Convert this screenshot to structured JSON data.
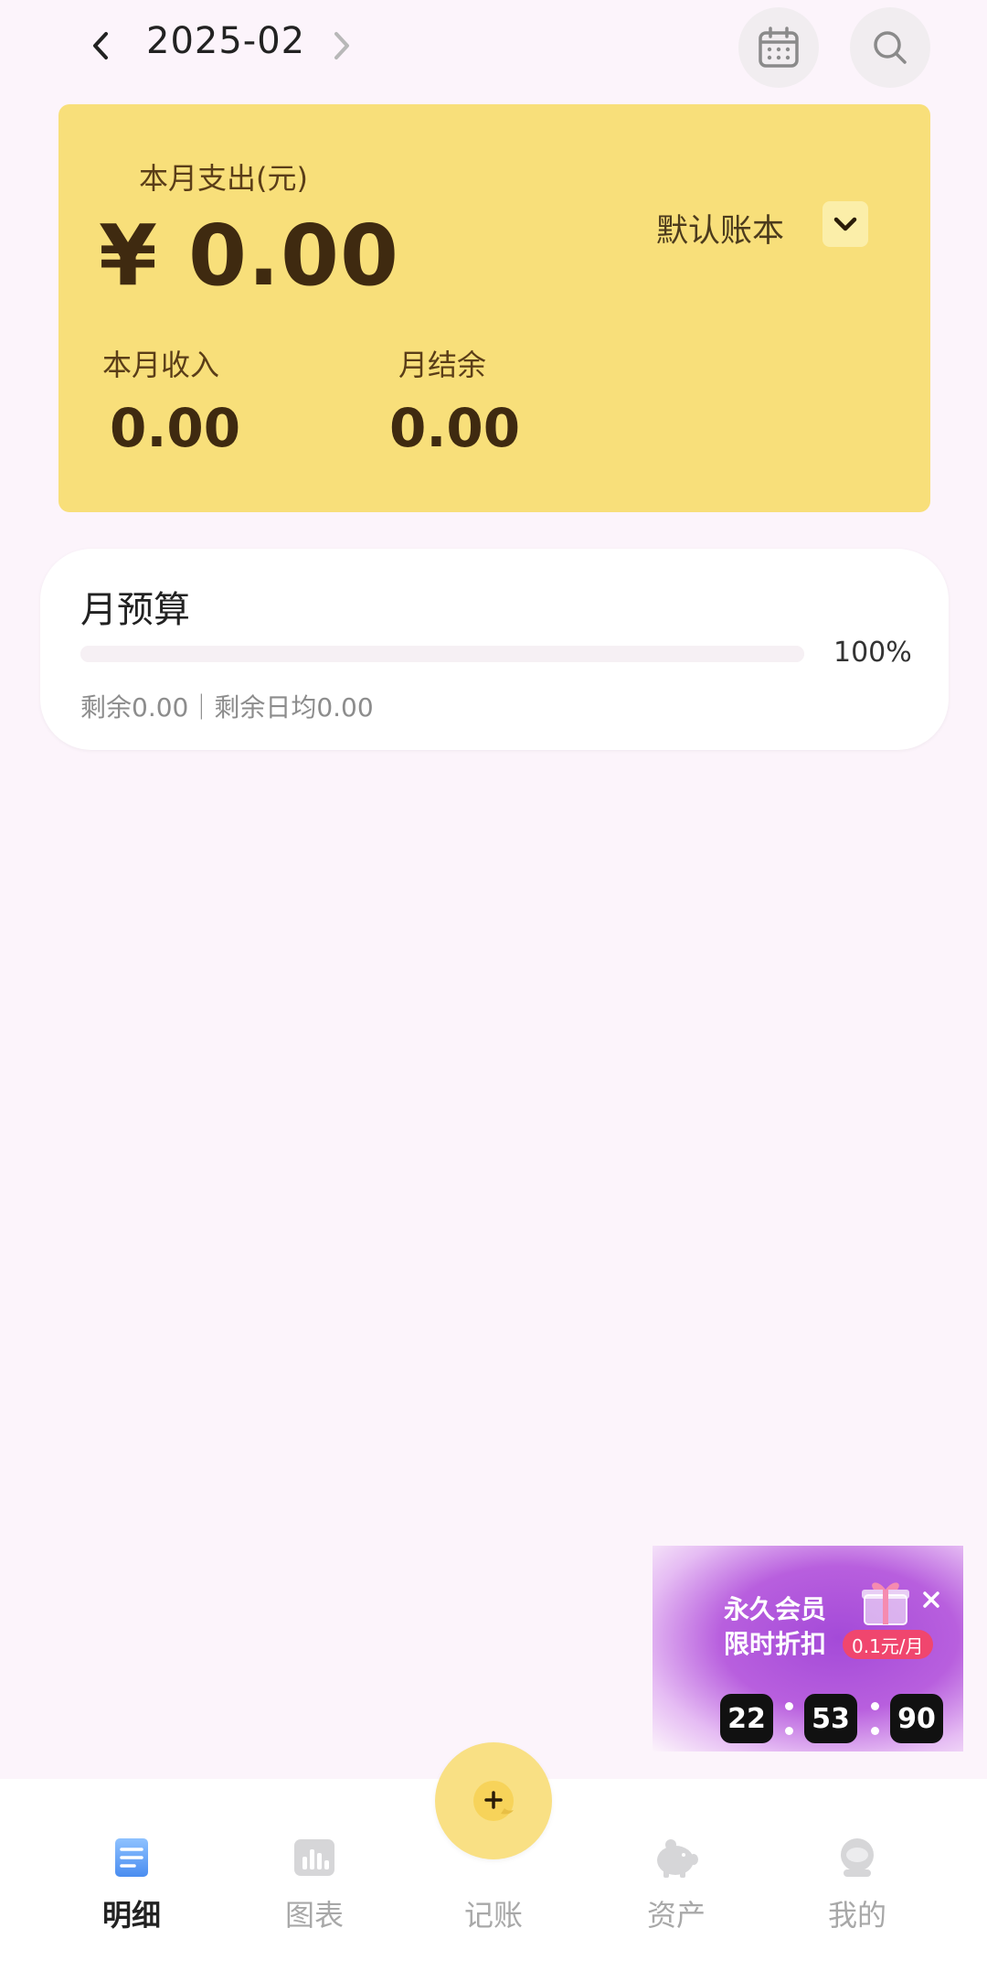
{
  "header": {
    "month": "2025-02"
  },
  "summary": {
    "expense_label": "本月支出(元)",
    "expense_amount": "¥ 0.00",
    "book_name": "默认账本",
    "income_label": "本月收入",
    "income_value": "0.00",
    "balance_label": "月结余",
    "balance_value": "0.00",
    "accent_color": "#f8df7a"
  },
  "budget": {
    "title": "月预算",
    "percent": "100%",
    "progress_fraction": 1.0,
    "detail": "剩余0.00｜剩余日均0.00"
  },
  "promo": {
    "line1": "永久会员",
    "line2": "限时折扣",
    "price": "0.1元/月",
    "countdown": [
      "22",
      "53",
      "90"
    ],
    "gradient_color": "#a44ad8"
  },
  "bottom_nav": {
    "items": [
      {
        "label": "明细",
        "icon": "list-document-icon",
        "active": true
      },
      {
        "label": "图表",
        "icon": "bar-chart-icon",
        "active": false
      },
      {
        "label": "记账",
        "icon": "add-record-icon",
        "active": false
      },
      {
        "label": "资产",
        "icon": "piggy-bank-icon",
        "active": false
      },
      {
        "label": "我的",
        "icon": "profile-icon",
        "active": false
      }
    ]
  }
}
